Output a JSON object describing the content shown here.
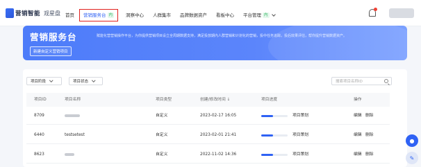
{
  "app": {
    "logo_main": "营销智能",
    "logo_sub": "观星盘"
  },
  "nav": {
    "items": [
      {
        "label": "首页",
        "active": false,
        "badge": "",
        "dropdown": false
      },
      {
        "label": "营销服务台",
        "active": true,
        "badge": "内",
        "dropdown": false
      },
      {
        "label": "洞察中心",
        "active": false,
        "badge": "",
        "dropdown": false
      },
      {
        "label": "人群集市",
        "active": false,
        "badge": "",
        "dropdown": false
      },
      {
        "label": "品牌数据资产",
        "active": false,
        "badge": "",
        "dropdown": false
      },
      {
        "label": "看板中心",
        "active": false,
        "badge": "",
        "dropdown": false
      },
      {
        "label": "平台管理",
        "active": false,
        "badge": "内",
        "dropdown": true
      }
    ]
  },
  "banner": {
    "title": "营销服务台",
    "description": "赋能化营营销操作平台，为你提供营销项目设立全周期数据支持，满足投放期内人群营销和计划化的营销，投中任务追踪，投后效果评估，帮你提升营销数据资产。",
    "button_label": "新建自定义营销项目"
  },
  "filters": {
    "stage_label": "项目阶段",
    "status_label": "项目状态",
    "search_placeholder": "搜索项目名称ID"
  },
  "table": {
    "columns": [
      "项目ID",
      "项目名称",
      "项目类型",
      "创建/修改时间 ↓",
      "项目进度",
      "操作"
    ],
    "rows": [
      {
        "id": "8709",
        "name": "",
        "type": "自定义",
        "time": "2023-02-17 16:05",
        "progress": 0.45,
        "stage": "项目策划",
        "actions": [
          "编辑",
          "删除"
        ]
      },
      {
        "id": "6440",
        "name": "testsetest",
        "type": "自定义",
        "time": "2023-02-01 21:41",
        "progress": 0.45,
        "stage": "项目策划",
        "actions": [
          "编辑",
          "删除"
        ]
      },
      {
        "id": "8623",
        "name": "",
        "type": "自定义",
        "time": "2022-11-02 14:36",
        "progress": 0.45,
        "stage": "项目策划",
        "actions": [
          "编辑",
          "删除"
        ]
      }
    ]
  },
  "colors": {
    "accent": "#2f62f4",
    "banner": "#5b85fb",
    "highlight_border": "#e0201d"
  }
}
